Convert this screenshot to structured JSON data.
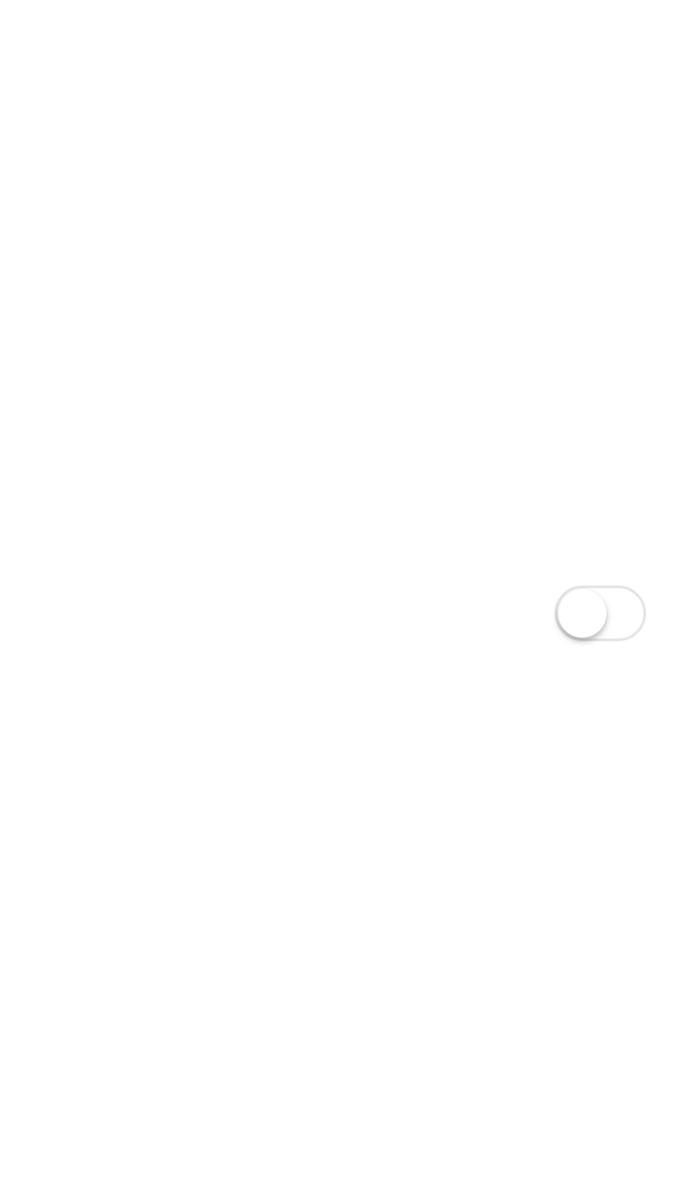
{
  "toggle": {
    "state": "off",
    "track_border_color": "#e5e5e5",
    "knob_color": "#ffffff"
  },
  "colors": {
    "background": "#ffffff"
  }
}
